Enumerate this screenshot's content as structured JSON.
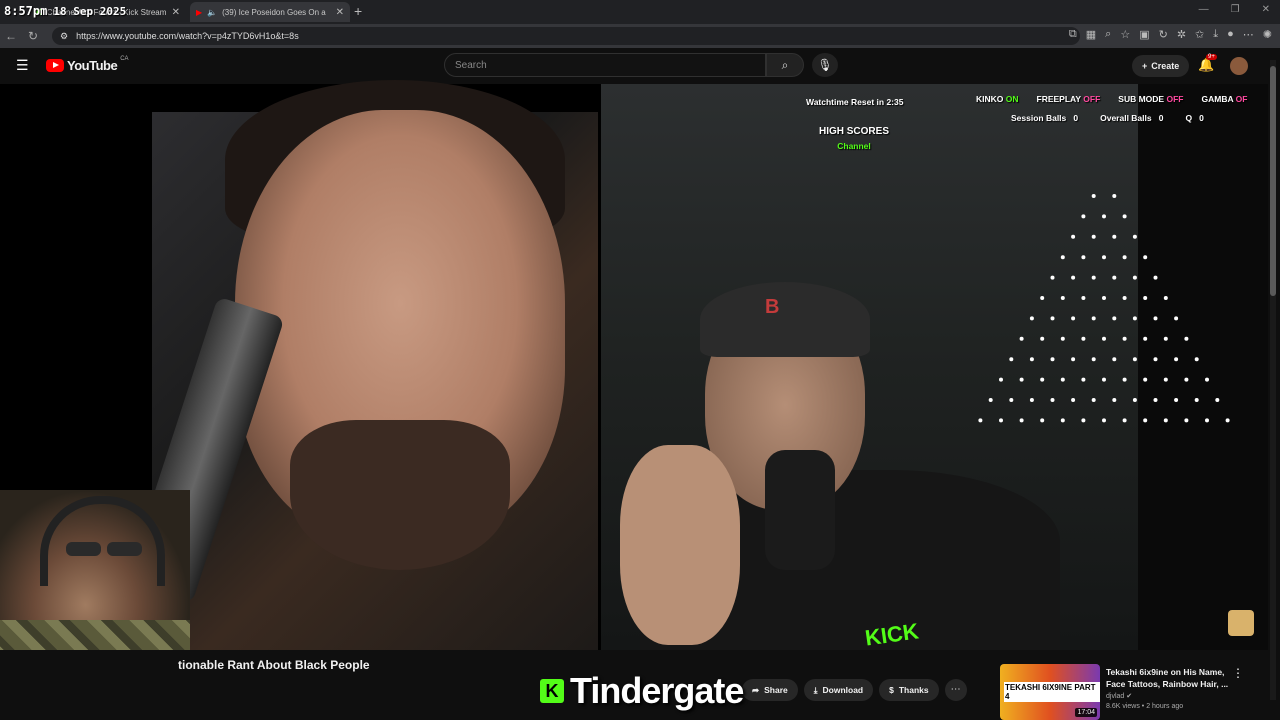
{
  "overlay_clock": {
    "time": "8:57pm",
    "date": "18 Sep 2025"
  },
  "browser": {
    "tabs": [
      {
        "title": "Channel Not Found - Kick Stream",
        "close": "✕"
      },
      {
        "title": "(39) Ice Poseidon Goes On a",
        "close": "✕"
      }
    ],
    "new_tab": "+",
    "url": "https://www.youtube.com/watch?v=p4zTYD6vH1o&t=8s",
    "window_controls": [
      "—",
      "❐",
      "✕"
    ]
  },
  "youtube": {
    "logo_text": "YouTube",
    "country": "CA",
    "search_placeholder": "Search",
    "create_label": "Create",
    "notification_count": "9+",
    "brand_color": "#ff0000"
  },
  "stream_overlay": {
    "watchtime": "Watchtime Reset in 2:35",
    "toggles": [
      {
        "label": "KINKO",
        "state": "ON"
      },
      {
        "label": "FREEPLAY",
        "state": "OFF"
      },
      {
        "label": "SUB MODE",
        "state": "OFF"
      },
      {
        "label": "GAMBA",
        "state": "OF"
      }
    ],
    "stats": [
      {
        "label": "Session Balls",
        "value": "0"
      },
      {
        "label": "Overall Balls",
        "value": "0"
      },
      {
        "label": "Q",
        "value": "0"
      }
    ],
    "high_scores_title": "HIGH SCORES",
    "high_scores_sub": "Channel",
    "shirt_text": "KICK",
    "cap_text": "B"
  },
  "video": {
    "title": "tionable Rant About Black People",
    "caption": "Tindergate",
    "caption_logo": "K",
    "actions": [
      {
        "icon": "share-icon",
        "label": "Share"
      },
      {
        "icon": "download-icon",
        "label": "Download"
      },
      {
        "icon": "thanks-icon",
        "label": "Thanks"
      }
    ],
    "more": "⋯"
  },
  "recommended": {
    "title": "Tekashi 6ix9ine on His Name, Face Tattoos, Rainbow Hair, ...",
    "channel": "djvlad",
    "meta": "8.6K views • 2 hours ago",
    "thumb_text": "TEKASHI 6IX9INE PART 4",
    "duration": "17:04"
  }
}
